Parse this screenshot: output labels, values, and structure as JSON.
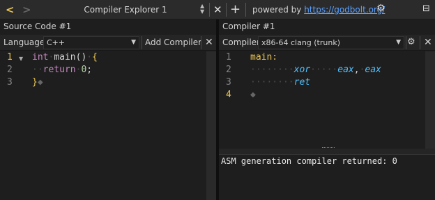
{
  "topbar": {
    "title": "Compiler Explorer 1",
    "powered_prefix": "powered by",
    "powered_link": "https://godbolt.org/"
  },
  "source_pane": {
    "tab_title": "Source Code #1",
    "language_label": "Language:",
    "language_value": "C++",
    "add_compiler_label": "Add Compiler",
    "line_numbers": [
      "1",
      "2",
      "3"
    ],
    "active_line": "1"
  },
  "compiler_pane": {
    "tab_title": "Compiler #1",
    "compiler_label": "Compiler:",
    "compiler_value": "x86-64 clang (trunk)",
    "line_numbers": [
      "1",
      "2",
      "3",
      "4"
    ],
    "active_line": "4",
    "output_text": "ASM generation compiler returned: 0"
  },
  "source_code": {
    "l1_kw": "int",
    "l1_rest": "main()",
    "l1_brace": "{",
    "l2_kw": "return",
    "l2_num": "0",
    "l2_semi": ";",
    "l3_brace": "}"
  },
  "asm_code": {
    "label": "main:",
    "l2_instr": "xor",
    "l2_op1": "eax",
    "l2_comma": ",",
    "l2_op2": "eax",
    "l3_instr": "ret"
  },
  "colors": {
    "accent_yellow": "#e8c352",
    "link_blue": "#5aa0ff",
    "keyword_purple": "#c586c0",
    "asm_blue": "#4fc1ff"
  }
}
